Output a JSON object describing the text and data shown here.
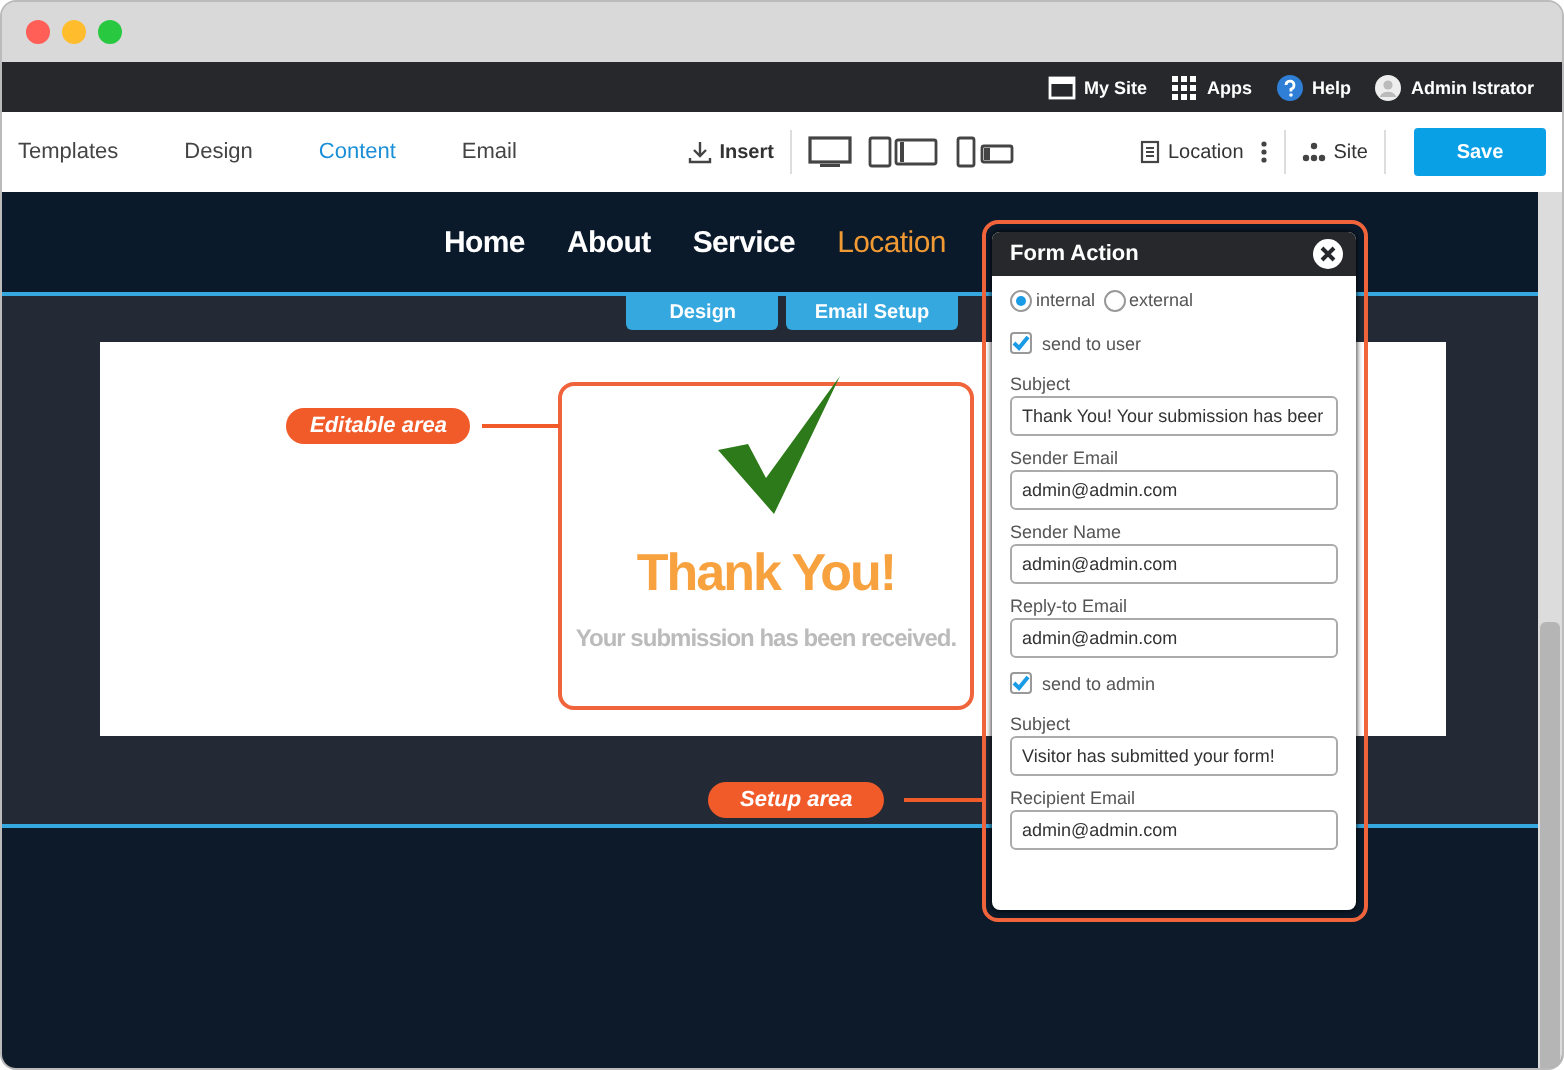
{
  "top_bar": {
    "items": [
      {
        "kind": "site",
        "label": "My Site"
      },
      {
        "kind": "apps",
        "label": "Apps"
      },
      {
        "kind": "help",
        "label": "Help"
      },
      {
        "kind": "user",
        "label": "Admin Istrator"
      }
    ]
  },
  "toolbar": {
    "tabs": [
      {
        "label": "Templates",
        "selected": false
      },
      {
        "label": "Design",
        "selected": false
      },
      {
        "label": "Content",
        "selected": true
      },
      {
        "label": "Email",
        "selected": false
      }
    ],
    "insert": "Insert",
    "page": "Location",
    "site": "Site",
    "save": "Save"
  },
  "site_nav": [
    {
      "label": "Home",
      "selected": false
    },
    {
      "label": "About",
      "selected": false
    },
    {
      "label": "Service",
      "selected": false
    },
    {
      "label": "Location",
      "selected": true
    }
  ],
  "mode_buttons": [
    "Design",
    "Email Setup"
  ],
  "thank_you": {
    "title": "Thank You!",
    "message": "Your submission has been received."
  },
  "callouts": {
    "editable": "Editable area",
    "setup": "Setup area"
  },
  "form_action": {
    "title": "Form Action",
    "options": [
      {
        "label": "internal",
        "selected": true
      },
      {
        "label": "external",
        "selected": false
      }
    ],
    "fields": [
      {
        "kind": "check",
        "label": "send to user",
        "checked": true
      },
      {
        "kind": "input",
        "label": "Subject",
        "value": "Thank You! Your submission has beer"
      },
      {
        "kind": "input",
        "label": "Sender Email",
        "value": "admin@admin.com"
      },
      {
        "kind": "input",
        "label": "Sender Name",
        "value": "admin@admin.com"
      },
      {
        "kind": "input",
        "label": "Reply-to Email",
        "value": "admin@admin.com"
      },
      {
        "kind": "check",
        "label": "send to admin",
        "checked": true
      },
      {
        "kind": "input",
        "label": "Subject",
        "value": "Visitor has submitted your form!"
      },
      {
        "kind": "input",
        "label": "Recipient Email",
        "value": "admin@admin.com"
      }
    ]
  }
}
